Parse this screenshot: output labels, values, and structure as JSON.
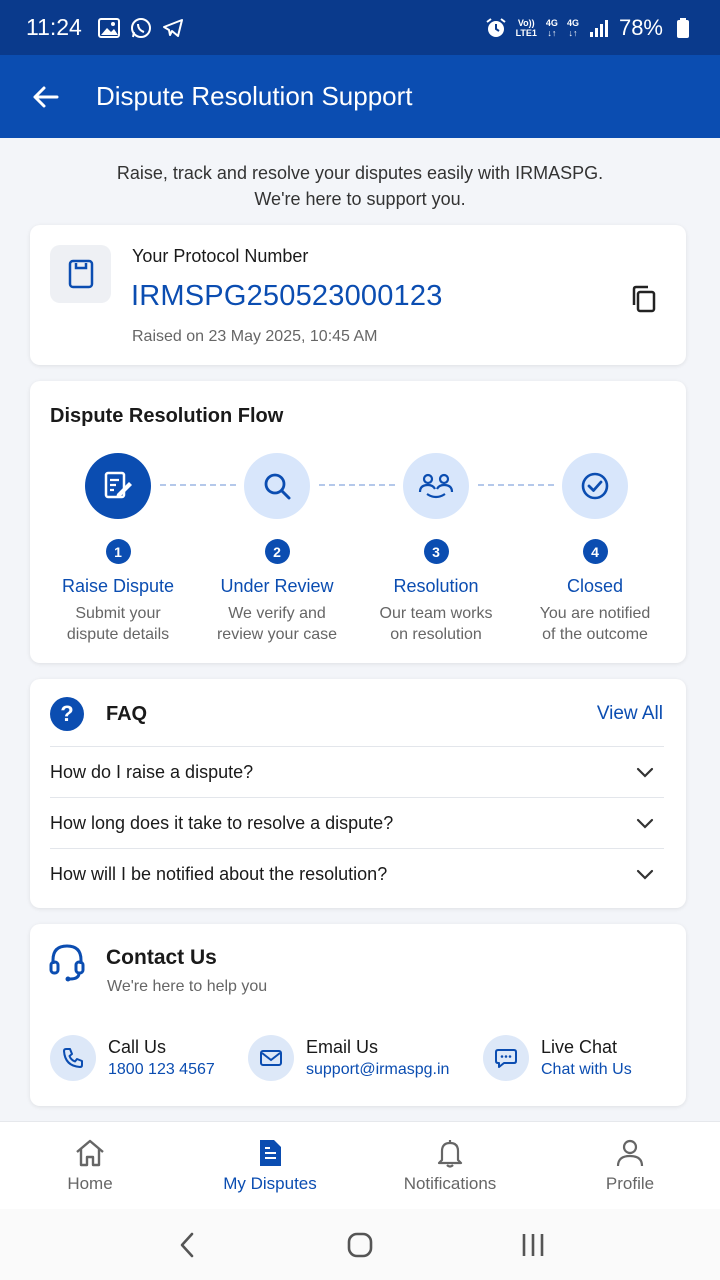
{
  "status_bar": {
    "time": "11:24",
    "network_volte": "Vo))",
    "network_lte": "LTE1",
    "net_4g_1": "4G",
    "net_4g_2": "4G",
    "battery": "78%"
  },
  "app_bar": {
    "title": "Dispute Resolution Support"
  },
  "intro": {
    "line1": "Raise, track and resolve your disputes easily with IRMASPG.",
    "line2": "We're here to support you."
  },
  "protocol": {
    "label": "Your Protocol Number",
    "number": "IRMSPG250523000123",
    "raised_on": "Raised on 23 May 2025, 10:45 AM"
  },
  "flow": {
    "title": "Dispute Resolution Flow",
    "steps": [
      {
        "num": "1",
        "title": "Raise Dispute",
        "desc1": "Submit your",
        "desc2": "dispute details",
        "icon": "edit-document-icon"
      },
      {
        "num": "2",
        "title": "Under Review",
        "desc1": "We verify and",
        "desc2": "review your case",
        "icon": "search-icon"
      },
      {
        "num": "3",
        "title": "Resolution",
        "desc1": "Our team works",
        "desc2": "on resolution",
        "icon": "team-handshake-icon"
      },
      {
        "num": "4",
        "title": "Closed",
        "desc1": "You are notified",
        "desc2": "of the outcome",
        "icon": "check-circle-icon"
      }
    ]
  },
  "faq": {
    "title": "FAQ",
    "view_all": "View All",
    "items": [
      "How do I raise a dispute?",
      "How long does it take to resolve a dispute?",
      "How will I be notified about the resolution?"
    ]
  },
  "contact": {
    "title": "Contact Us",
    "subtitle": "We're here to help you",
    "options": [
      {
        "title": "Call Us",
        "value": "1800 123 4567",
        "icon": "phone-icon"
      },
      {
        "title": "Email Us",
        "value": "support@irmaspg.in",
        "icon": "mail-icon"
      },
      {
        "title": "Live Chat",
        "value": "Chat with Us",
        "icon": "chat-icon"
      }
    ]
  },
  "bottom_nav": [
    {
      "label": "Home",
      "icon": "home-icon"
    },
    {
      "label": "My Disputes",
      "icon": "document-icon",
      "active": true
    },
    {
      "label": "Notifications",
      "icon": "bell-icon"
    },
    {
      "label": "Profile",
      "icon": "person-icon"
    }
  ],
  "colors": {
    "primary": "#0b4db1",
    "status_bar": "#0a3a8c",
    "light_blue": "#d8e6fb",
    "background": "#f3f5f9"
  }
}
